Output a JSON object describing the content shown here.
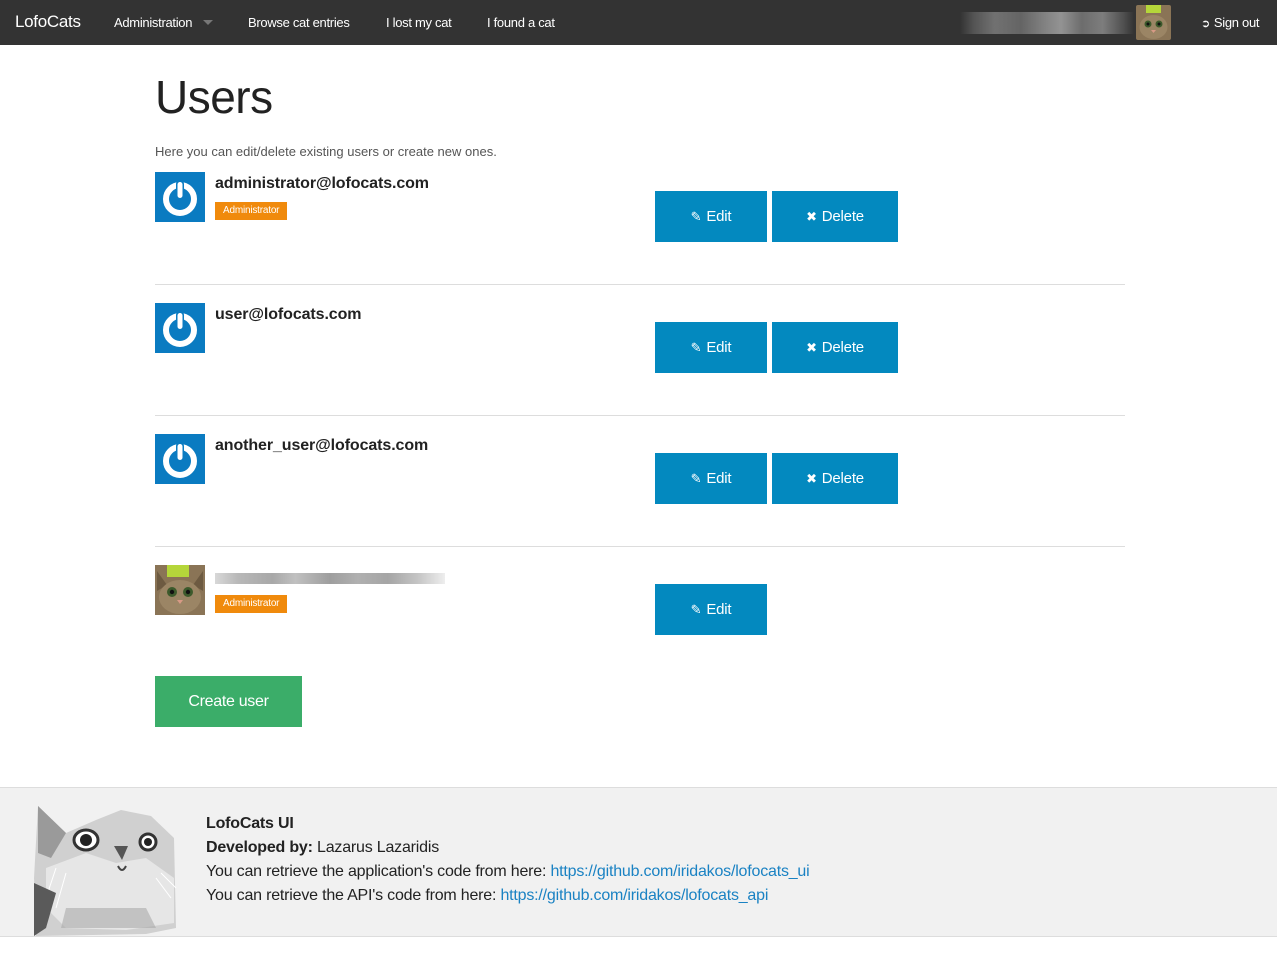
{
  "navbar": {
    "brand": "LofoCats",
    "items": [
      {
        "label": "Administration",
        "has_dropdown": true
      },
      {
        "label": "Browse cat entries"
      },
      {
        "label": "I lost my cat"
      },
      {
        "label": "I found a cat"
      }
    ],
    "signout_label": "Sign out",
    "signout_icon": "sign-out-icon"
  },
  "page": {
    "title": "Users",
    "subtitle": "Here you can edit/delete existing users or create new ones."
  },
  "users": [
    {
      "email": "administrator@lofocats.com",
      "role": "Administrator",
      "avatar": "power-avatar",
      "actions": {
        "edit": "Edit",
        "delete": "Delete"
      }
    },
    {
      "email": "user@lofocats.com",
      "role": null,
      "avatar": "power-avatar",
      "actions": {
        "edit": "Edit",
        "delete": "Delete"
      }
    },
    {
      "email": "another_user@lofocats.com",
      "role": null,
      "avatar": "power-avatar",
      "actions": {
        "edit": "Edit",
        "delete": "Delete"
      }
    },
    {
      "email": "[redacted]",
      "role": "Administrator",
      "avatar": "cat-photo-avatar",
      "actions": {
        "edit": "Edit"
      }
    }
  ],
  "create_user_label": "Create user",
  "footer": {
    "title": "LofoCats UI",
    "developed_by_label": "Developed by:",
    "developer": "Lazarus Lazaridis",
    "app_code_text": "You can retrieve the application's code from here:",
    "app_code_link": "https://github.com/iridakos/lofocats_ui",
    "api_code_text": "You can retrieve the API's code from here:",
    "api_code_link": "https://github.com/iridakos/lofocats_api"
  },
  "colors": {
    "navbar": "#333333",
    "primary_button": "#0389bf",
    "success_button": "#3bad69",
    "badge": "#f08a0c",
    "link": "#1a82c3"
  }
}
